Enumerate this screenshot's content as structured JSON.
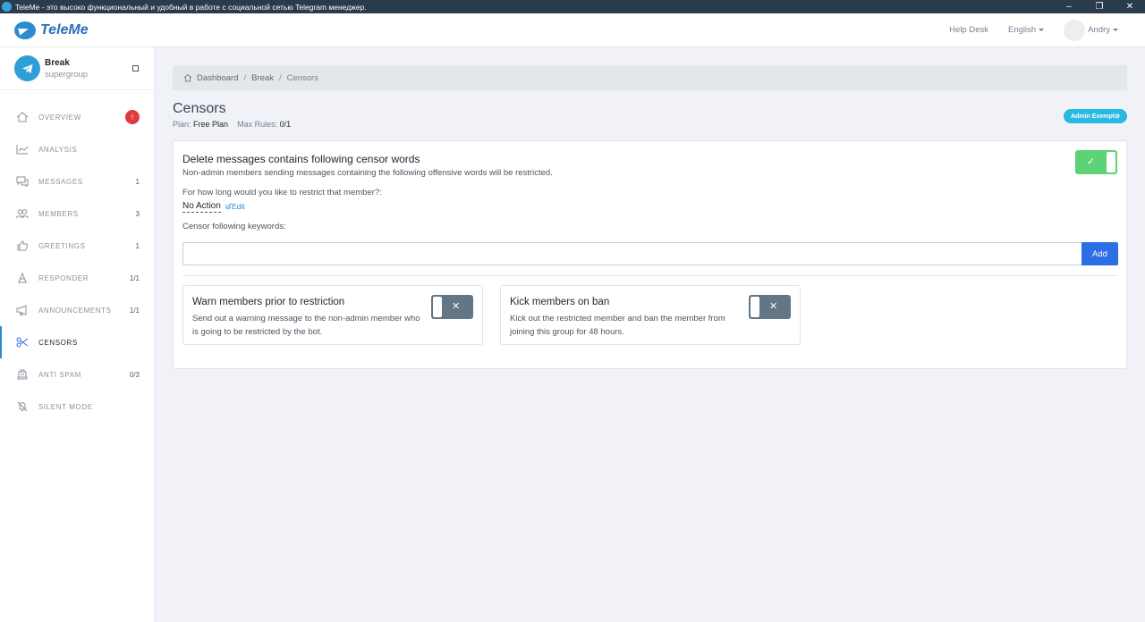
{
  "window": {
    "title": "TeleMe - это высоко функциональный и удобный в работе с социальной сетью Telegram менеджер.",
    "minimize": "–",
    "restore": "❐",
    "close": "✕"
  },
  "header": {
    "logo": "TeleMe",
    "help_desk": "Help Desk",
    "language": "English",
    "user": "Andry"
  },
  "group": {
    "name": "Break",
    "type": "supergroup"
  },
  "sidebar": {
    "items": [
      {
        "label": "OVERVIEW",
        "icon": "home-icon",
        "count": "",
        "alert": "!"
      },
      {
        "label": "ANALYSIS",
        "icon": "chart-icon",
        "count": ""
      },
      {
        "label": "MESSAGES",
        "icon": "messages-icon",
        "count": "1"
      },
      {
        "label": "MEMBERS",
        "icon": "members-icon",
        "count": "3"
      },
      {
        "label": "GREETINGS",
        "icon": "thumbs-up-icon",
        "count": "1"
      },
      {
        "label": "RESPONDER",
        "icon": "responder-icon",
        "count": "1/1"
      },
      {
        "label": "ANNOUNCEMENTS",
        "icon": "megaphone-icon",
        "count": "1/1"
      },
      {
        "label": "CENSORS",
        "icon": "scissors-icon",
        "count": "",
        "active": true
      },
      {
        "label": "ANTI SPAM",
        "icon": "shield-icon",
        "count": "0/3"
      },
      {
        "label": "SILENT MODE",
        "icon": "mute-icon",
        "count": ""
      }
    ]
  },
  "breadcrumb": [
    "Dashboard",
    "Break",
    "Censors"
  ],
  "page": {
    "title": "Censors",
    "plan_label": "Plan:",
    "plan_value": "Free Plan",
    "rules_label": "Max Rules:",
    "rules_value": "0/1",
    "admin_badge": "Admin Exempt⊘"
  },
  "censor_card": {
    "title": "Delete messages contains following censor words",
    "description": "Non-admin members sending messages containing the following offensive words will be restricted.",
    "question": "For how long would you like to restrict that member?:",
    "action": "No Action",
    "edit": "Edit",
    "keywords_label": "Censor following keywords:",
    "keywords_value": "",
    "add_button": "Add",
    "enabled": true,
    "on_mark": "✓"
  },
  "warn_card": {
    "title": "Warn members prior to restriction",
    "description": "Send out a warning message to the non-admin member who is going to be restricted by the bot.",
    "enabled": false,
    "off_mark": "✕"
  },
  "kick_card": {
    "title": "Kick members on ban",
    "description": "Kick out the restricted member and ban the member from joining this group for 48 hours.",
    "enabled": false,
    "off_mark": "✕"
  }
}
